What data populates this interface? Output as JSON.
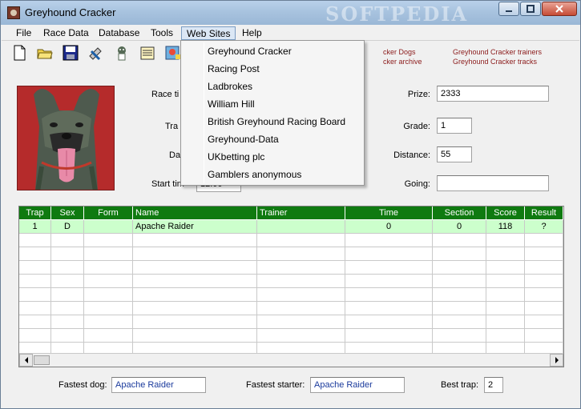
{
  "window": {
    "title": "Greyhound Cracker",
    "watermark": "SOFTPEDIA"
  },
  "menu": [
    "File",
    "Race Data",
    "Database",
    "Tools",
    "Web Sites",
    "Help"
  ],
  "toolbar": {
    "icons": [
      "new-document-icon",
      "open-folder-icon",
      "save-disk-icon",
      "tools-icon",
      "dog-icon",
      "notes-icon",
      "map-icon"
    ]
  },
  "top_links": {
    "col1": [
      "cker Dogs",
      "cker archive"
    ],
    "col2": [
      "Greyhound Cracker trainers",
      "Greyhound Cracker tracks"
    ]
  },
  "form": {
    "race_time_label": "Race ti",
    "trap_label": "Tra",
    "date_label": "Da",
    "start_time_label": "Start tim",
    "start_time_value": "12:00",
    "prize_label": "Prize:",
    "prize_value": "2333",
    "grade_label": "Grade:",
    "grade_value": "1",
    "distance_label": "Distance:",
    "distance_value": "55",
    "going_label": "Going:",
    "going_value": ""
  },
  "grid": {
    "columns": [
      "Trap",
      "Sex",
      "Form",
      "Name",
      "Trainer",
      "Time",
      "Section",
      "Score",
      "Result"
    ],
    "rows": [
      [
        "1",
        "D",
        "",
        "Apache Raider",
        "",
        "0",
        "0",
        "118",
        "?"
      ]
    ],
    "empty_rows": 9
  },
  "footer": {
    "fastest_dog_label": "Fastest dog:",
    "fastest_dog_value": "Apache Raider",
    "fastest_starter_label": "Fastest starter:",
    "fastest_starter_value": "Apache Raider",
    "best_trap_label": "Best trap:",
    "best_trap_value": "2"
  },
  "websites_menu": {
    "items": [
      "Greyhound Cracker",
      "Racing Post",
      "Ladbrokes",
      "William Hill",
      "British Greyhound Racing Board",
      "Greyhound-Data",
      "UKbetting plc",
      "Gamblers anonymous"
    ]
  },
  "colors": {
    "grid_header": "#0f7a10",
    "selected_row": "#ccffcc",
    "link_red": "#8b1a1a"
  }
}
